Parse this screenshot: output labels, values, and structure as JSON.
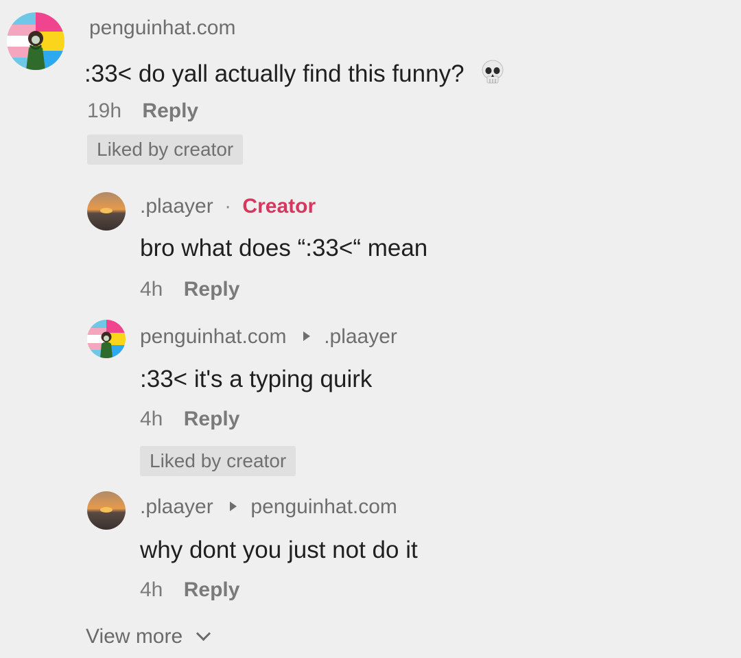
{
  "comments": [
    {
      "username": "penguinhat.com",
      "text": ":33< do yall actually find this funny?",
      "emoji": "💀",
      "time": "19h",
      "reply_label": "Reply",
      "liked_label": "Liked by creator"
    },
    {
      "username": ".plaayer",
      "separator": "·",
      "tag": "Creator",
      "text": "bro what does “:33<“ mean",
      "time": "4h",
      "reply_label": "Reply"
    },
    {
      "username": "penguinhat.com",
      "reply_to": ".plaayer",
      "text": ":33< it's a typing quirk",
      "time": "4h",
      "reply_label": "Reply",
      "liked_label": "Liked by creator"
    },
    {
      "username": ".plaayer",
      "reply_to": "penguinhat.com",
      "text": "why dont you just not do it",
      "time": "4h",
      "reply_label": "Reply"
    }
  ],
  "view_more_label": "View more",
  "colors": {
    "background": "#efefef",
    "creator_tag": "#d9365e",
    "username": "#6e6e6e",
    "body_text": "#1f1f1f",
    "pill_bg": "#e0e0e0"
  },
  "icons": {
    "main_avatar": "pride-flag-avatar",
    "creator_avatar": "sunset-avatar",
    "emoji": "skull-emoji",
    "reply_arrow": "play-arrow-icon",
    "view_more": "chevron-down-icon"
  }
}
